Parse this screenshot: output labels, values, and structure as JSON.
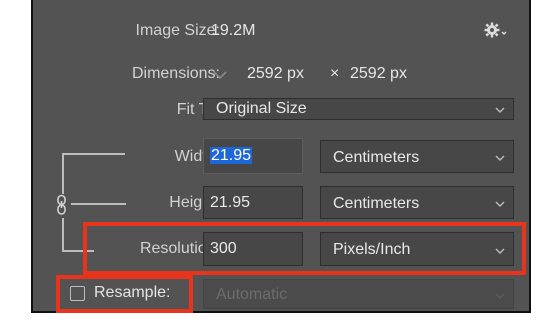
{
  "image_size": {
    "label": "Image Size:",
    "value": "19.2M"
  },
  "dimensions": {
    "label": "Dimensions:",
    "width": "2592 px",
    "times": "×",
    "height": "2592 px"
  },
  "fit_to": {
    "label": "Fit To:",
    "value": "Original Size"
  },
  "width": {
    "label": "Width:",
    "value": "21.95",
    "unit": "Centimeters"
  },
  "height": {
    "label": "Height:",
    "value": "21.95",
    "unit": "Centimeters"
  },
  "resolution": {
    "label": "Resolution:",
    "value": "300",
    "unit": "Pixels/Inch"
  },
  "resample": {
    "label": "Resample:",
    "value": "Automatic",
    "checked": false
  },
  "colors": {
    "panel": "#535353",
    "highlight": "#e8341c",
    "selection": "#1d68d6"
  },
  "icons": [
    "gear-icon",
    "chevron-down-icon",
    "chain-link-icon",
    "checkbox"
  ]
}
